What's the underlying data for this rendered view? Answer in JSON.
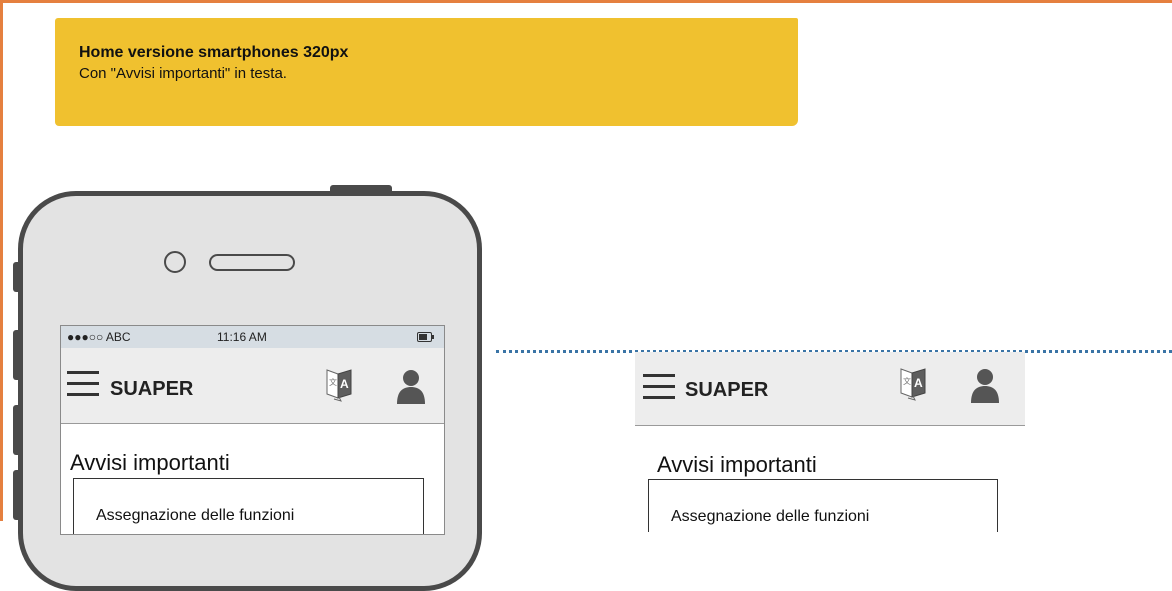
{
  "note": {
    "title": "Home versione smartphones 320px",
    "body": "Con \"Avvisi importanti\" in testa."
  },
  "statusbar": {
    "carrier": "●●●○○ ABC",
    "time": "11:16 AM"
  },
  "header": {
    "brand": "SUAPER",
    "icons": [
      "hamburger-menu-icon",
      "translate-icon",
      "user-icon"
    ]
  },
  "content": {
    "section_title": "Avvisi importanti",
    "first_notice": "Assegnazione delle funzioni"
  },
  "colors": {
    "note_bg": "#F0C12F",
    "frame_border": "#E5803F",
    "phone_body": "#E3E3E3",
    "phone_outline": "#4A4A4A",
    "statusbar_bg": "#D6DDE3",
    "header_bg": "#EDEDED",
    "divider_dots": "#3A74A6"
  }
}
